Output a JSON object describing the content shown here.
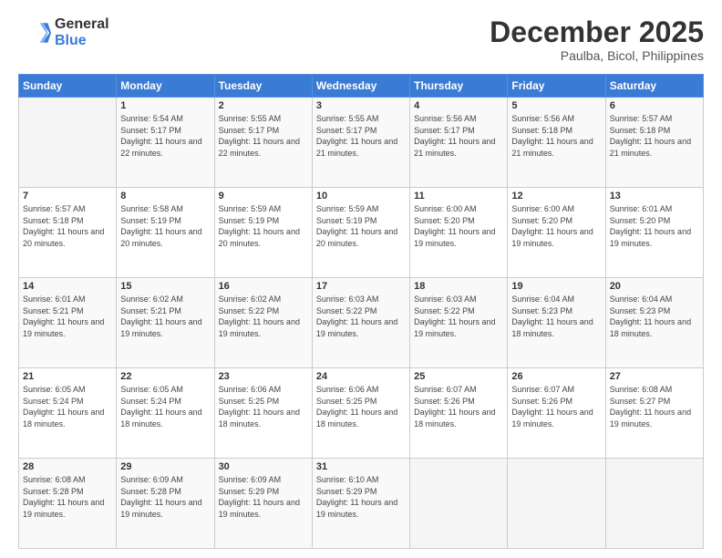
{
  "header": {
    "logo_general": "General",
    "logo_blue": "Blue",
    "month_title": "December 2025",
    "subtitle": "Paulba, Bicol, Philippines"
  },
  "calendar": {
    "days_of_week": [
      "Sunday",
      "Monday",
      "Tuesday",
      "Wednesday",
      "Thursday",
      "Friday",
      "Saturday"
    ],
    "weeks": [
      [
        {
          "day": "",
          "sunrise": "",
          "sunset": "",
          "daylight": ""
        },
        {
          "day": "1",
          "sunrise": "Sunrise: 5:54 AM",
          "sunset": "Sunset: 5:17 PM",
          "daylight": "Daylight: 11 hours and 22 minutes."
        },
        {
          "day": "2",
          "sunrise": "Sunrise: 5:55 AM",
          "sunset": "Sunset: 5:17 PM",
          "daylight": "Daylight: 11 hours and 22 minutes."
        },
        {
          "day": "3",
          "sunrise": "Sunrise: 5:55 AM",
          "sunset": "Sunset: 5:17 PM",
          "daylight": "Daylight: 11 hours and 21 minutes."
        },
        {
          "day": "4",
          "sunrise": "Sunrise: 5:56 AM",
          "sunset": "Sunset: 5:17 PM",
          "daylight": "Daylight: 11 hours and 21 minutes."
        },
        {
          "day": "5",
          "sunrise": "Sunrise: 5:56 AM",
          "sunset": "Sunset: 5:18 PM",
          "daylight": "Daylight: 11 hours and 21 minutes."
        },
        {
          "day": "6",
          "sunrise": "Sunrise: 5:57 AM",
          "sunset": "Sunset: 5:18 PM",
          "daylight": "Daylight: 11 hours and 21 minutes."
        }
      ],
      [
        {
          "day": "7",
          "sunrise": "Sunrise: 5:57 AM",
          "sunset": "Sunset: 5:18 PM",
          "daylight": "Daylight: 11 hours and 20 minutes."
        },
        {
          "day": "8",
          "sunrise": "Sunrise: 5:58 AM",
          "sunset": "Sunset: 5:19 PM",
          "daylight": "Daylight: 11 hours and 20 minutes."
        },
        {
          "day": "9",
          "sunrise": "Sunrise: 5:59 AM",
          "sunset": "Sunset: 5:19 PM",
          "daylight": "Daylight: 11 hours and 20 minutes."
        },
        {
          "day": "10",
          "sunrise": "Sunrise: 5:59 AM",
          "sunset": "Sunset: 5:19 PM",
          "daylight": "Daylight: 11 hours and 20 minutes."
        },
        {
          "day": "11",
          "sunrise": "Sunrise: 6:00 AM",
          "sunset": "Sunset: 5:20 PM",
          "daylight": "Daylight: 11 hours and 19 minutes."
        },
        {
          "day": "12",
          "sunrise": "Sunrise: 6:00 AM",
          "sunset": "Sunset: 5:20 PM",
          "daylight": "Daylight: 11 hours and 19 minutes."
        },
        {
          "day": "13",
          "sunrise": "Sunrise: 6:01 AM",
          "sunset": "Sunset: 5:20 PM",
          "daylight": "Daylight: 11 hours and 19 minutes."
        }
      ],
      [
        {
          "day": "14",
          "sunrise": "Sunrise: 6:01 AM",
          "sunset": "Sunset: 5:21 PM",
          "daylight": "Daylight: 11 hours and 19 minutes."
        },
        {
          "day": "15",
          "sunrise": "Sunrise: 6:02 AM",
          "sunset": "Sunset: 5:21 PM",
          "daylight": "Daylight: 11 hours and 19 minutes."
        },
        {
          "day": "16",
          "sunrise": "Sunrise: 6:02 AM",
          "sunset": "Sunset: 5:22 PM",
          "daylight": "Daylight: 11 hours and 19 minutes."
        },
        {
          "day": "17",
          "sunrise": "Sunrise: 6:03 AM",
          "sunset": "Sunset: 5:22 PM",
          "daylight": "Daylight: 11 hours and 19 minutes."
        },
        {
          "day": "18",
          "sunrise": "Sunrise: 6:03 AM",
          "sunset": "Sunset: 5:22 PM",
          "daylight": "Daylight: 11 hours and 19 minutes."
        },
        {
          "day": "19",
          "sunrise": "Sunrise: 6:04 AM",
          "sunset": "Sunset: 5:23 PM",
          "daylight": "Daylight: 11 hours and 18 minutes."
        },
        {
          "day": "20",
          "sunrise": "Sunrise: 6:04 AM",
          "sunset": "Sunset: 5:23 PM",
          "daylight": "Daylight: 11 hours and 18 minutes."
        }
      ],
      [
        {
          "day": "21",
          "sunrise": "Sunrise: 6:05 AM",
          "sunset": "Sunset: 5:24 PM",
          "daylight": "Daylight: 11 hours and 18 minutes."
        },
        {
          "day": "22",
          "sunrise": "Sunrise: 6:05 AM",
          "sunset": "Sunset: 5:24 PM",
          "daylight": "Daylight: 11 hours and 18 minutes."
        },
        {
          "day": "23",
          "sunrise": "Sunrise: 6:06 AM",
          "sunset": "Sunset: 5:25 PM",
          "daylight": "Daylight: 11 hours and 18 minutes."
        },
        {
          "day": "24",
          "sunrise": "Sunrise: 6:06 AM",
          "sunset": "Sunset: 5:25 PM",
          "daylight": "Daylight: 11 hours and 18 minutes."
        },
        {
          "day": "25",
          "sunrise": "Sunrise: 6:07 AM",
          "sunset": "Sunset: 5:26 PM",
          "daylight": "Daylight: 11 hours and 18 minutes."
        },
        {
          "day": "26",
          "sunrise": "Sunrise: 6:07 AM",
          "sunset": "Sunset: 5:26 PM",
          "daylight": "Daylight: 11 hours and 19 minutes."
        },
        {
          "day": "27",
          "sunrise": "Sunrise: 6:08 AM",
          "sunset": "Sunset: 5:27 PM",
          "daylight": "Daylight: 11 hours and 19 minutes."
        }
      ],
      [
        {
          "day": "28",
          "sunrise": "Sunrise: 6:08 AM",
          "sunset": "Sunset: 5:28 PM",
          "daylight": "Daylight: 11 hours and 19 minutes."
        },
        {
          "day": "29",
          "sunrise": "Sunrise: 6:09 AM",
          "sunset": "Sunset: 5:28 PM",
          "daylight": "Daylight: 11 hours and 19 minutes."
        },
        {
          "day": "30",
          "sunrise": "Sunrise: 6:09 AM",
          "sunset": "Sunset: 5:29 PM",
          "daylight": "Daylight: 11 hours and 19 minutes."
        },
        {
          "day": "31",
          "sunrise": "Sunrise: 6:10 AM",
          "sunset": "Sunset: 5:29 PM",
          "daylight": "Daylight: 11 hours and 19 minutes."
        },
        {
          "day": "",
          "sunrise": "",
          "sunset": "",
          "daylight": ""
        },
        {
          "day": "",
          "sunrise": "",
          "sunset": "",
          "daylight": ""
        },
        {
          "day": "",
          "sunrise": "",
          "sunset": "",
          "daylight": ""
        }
      ]
    ]
  }
}
